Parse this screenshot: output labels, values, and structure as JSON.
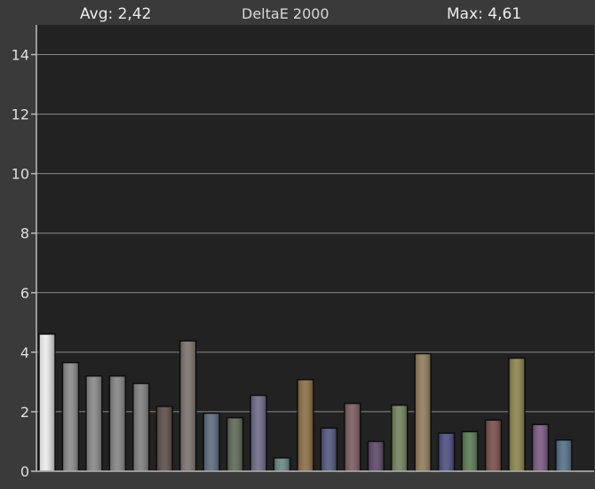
{
  "chart_data": {
    "type": "bar",
    "title": "DeltaE 2000",
    "avg_text": "Avg: 2,42",
    "max_text": "Max: 4,61",
    "ylim": [
      0,
      15
    ],
    "yticks": [
      "0",
      "2",
      "4",
      "6",
      "8",
      "10",
      "12",
      "14"
    ],
    "grid": true,
    "values": [
      4.61,
      3.65,
      3.2,
      3.2,
      2.95,
      2.18,
      4.38,
      1.95,
      1.8,
      2.55,
      0.45,
      3.08,
      1.45,
      2.28,
      1.0,
      2.22,
      3.95,
      1.28,
      1.33,
      1.72,
      3.8,
      1.57,
      1.05
    ],
    "colors": [
      "#ffffff",
      "#8a8a8a",
      "#878787",
      "#848484",
      "#7f7f7f",
      "#5c4e47",
      "#7b736e",
      "#5d6b7d",
      "#5e6856",
      "#6c6a87",
      "#6a8785",
      "#8a6e47",
      "#53577d",
      "#7a5c62",
      "#5c4866",
      "#74825f",
      "#8f7c5d",
      "#4e4f80",
      "#5b7856",
      "#7a4d4a",
      "#8b8350",
      "#7b5a82",
      "#556f87"
    ]
  }
}
